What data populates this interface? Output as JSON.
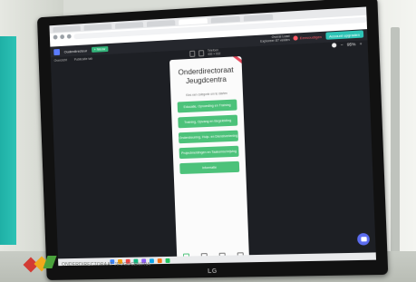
{
  "browser": {
    "tabs": [
      "",
      "",
      "",
      "",
      "",
      "",
      ""
    ],
    "address": "",
    "bookmarks": [
      "",
      "",
      "",
      "",
      "",
      "",
      "",
      ""
    ]
  },
  "app": {
    "project_name": "Ouderdirecteur",
    "new_button": "+ Nieuw",
    "sub_nav": [
      "Overzicht",
      "Publicatie tab"
    ],
    "device_label": "Telefoon",
    "device_size": "430 × 932",
    "limits_line1": "Overal Load",
    "limits_line2": "Exploreer 87 velden",
    "plan_label": "Eenvoudigen",
    "upgrade_label": "Account upgraden",
    "zoom_level": "95%",
    "zoom_minus": "−",
    "zoom_plus": "+"
  },
  "phone": {
    "title_line1": "Onderdirectoraat",
    "title_line2": "Jeugdcentra",
    "subtitle": "Kies een categorie om te starten",
    "menu_buttons": [
      "Educatie, Opvoeding en Training",
      "Training, Opvang en Begeleiding",
      "Ondersteuning, Hulp- en Dienstverlening",
      "Projectmeldingen en Taakomschrijving",
      "Informatie"
    ],
    "nav": [
      "",
      "",
      "",
      ""
    ]
  },
  "monitor": {
    "brand": "LG"
  },
  "backdrop": {
    "logo_text": "ONDERDIRECTORAAT JEUGDCENTRA"
  },
  "colors": {
    "accent_green": "#4cc27a",
    "upgrade_teal": "#2ec4b6",
    "plan_red": "#ff5a66",
    "app_bg": "#1d1f24"
  }
}
